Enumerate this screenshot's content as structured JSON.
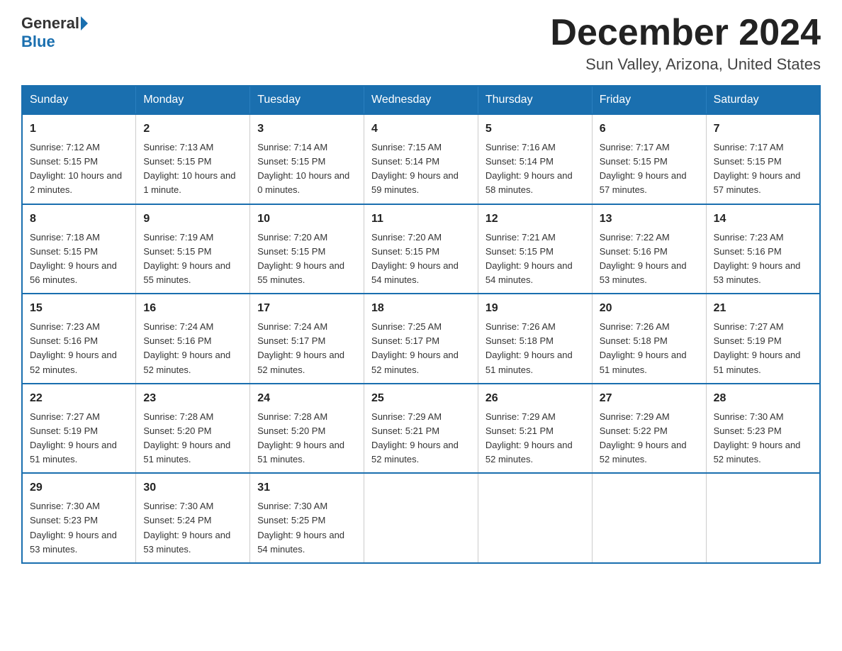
{
  "logo": {
    "general": "General",
    "blue": "Blue"
  },
  "title": "December 2024",
  "location": "Sun Valley, Arizona, United States",
  "days_of_week": [
    "Sunday",
    "Monday",
    "Tuesday",
    "Wednesday",
    "Thursday",
    "Friday",
    "Saturday"
  ],
  "weeks": [
    [
      {
        "day": "1",
        "sunrise": "7:12 AM",
        "sunset": "5:15 PM",
        "daylight": "10 hours and 2 minutes."
      },
      {
        "day": "2",
        "sunrise": "7:13 AM",
        "sunset": "5:15 PM",
        "daylight": "10 hours and 1 minute."
      },
      {
        "day": "3",
        "sunrise": "7:14 AM",
        "sunset": "5:15 PM",
        "daylight": "10 hours and 0 minutes."
      },
      {
        "day": "4",
        "sunrise": "7:15 AM",
        "sunset": "5:14 PM",
        "daylight": "9 hours and 59 minutes."
      },
      {
        "day": "5",
        "sunrise": "7:16 AM",
        "sunset": "5:14 PM",
        "daylight": "9 hours and 58 minutes."
      },
      {
        "day": "6",
        "sunrise": "7:17 AM",
        "sunset": "5:15 PM",
        "daylight": "9 hours and 57 minutes."
      },
      {
        "day": "7",
        "sunrise": "7:17 AM",
        "sunset": "5:15 PM",
        "daylight": "9 hours and 57 minutes."
      }
    ],
    [
      {
        "day": "8",
        "sunrise": "7:18 AM",
        "sunset": "5:15 PM",
        "daylight": "9 hours and 56 minutes."
      },
      {
        "day": "9",
        "sunrise": "7:19 AM",
        "sunset": "5:15 PM",
        "daylight": "9 hours and 55 minutes."
      },
      {
        "day": "10",
        "sunrise": "7:20 AM",
        "sunset": "5:15 PM",
        "daylight": "9 hours and 55 minutes."
      },
      {
        "day": "11",
        "sunrise": "7:20 AM",
        "sunset": "5:15 PM",
        "daylight": "9 hours and 54 minutes."
      },
      {
        "day": "12",
        "sunrise": "7:21 AM",
        "sunset": "5:15 PM",
        "daylight": "9 hours and 54 minutes."
      },
      {
        "day": "13",
        "sunrise": "7:22 AM",
        "sunset": "5:16 PM",
        "daylight": "9 hours and 53 minutes."
      },
      {
        "day": "14",
        "sunrise": "7:23 AM",
        "sunset": "5:16 PM",
        "daylight": "9 hours and 53 minutes."
      }
    ],
    [
      {
        "day": "15",
        "sunrise": "7:23 AM",
        "sunset": "5:16 PM",
        "daylight": "9 hours and 52 minutes."
      },
      {
        "day": "16",
        "sunrise": "7:24 AM",
        "sunset": "5:16 PM",
        "daylight": "9 hours and 52 minutes."
      },
      {
        "day": "17",
        "sunrise": "7:24 AM",
        "sunset": "5:17 PM",
        "daylight": "9 hours and 52 minutes."
      },
      {
        "day": "18",
        "sunrise": "7:25 AM",
        "sunset": "5:17 PM",
        "daylight": "9 hours and 52 minutes."
      },
      {
        "day": "19",
        "sunrise": "7:26 AM",
        "sunset": "5:18 PM",
        "daylight": "9 hours and 51 minutes."
      },
      {
        "day": "20",
        "sunrise": "7:26 AM",
        "sunset": "5:18 PM",
        "daylight": "9 hours and 51 minutes."
      },
      {
        "day": "21",
        "sunrise": "7:27 AM",
        "sunset": "5:19 PM",
        "daylight": "9 hours and 51 minutes."
      }
    ],
    [
      {
        "day": "22",
        "sunrise": "7:27 AM",
        "sunset": "5:19 PM",
        "daylight": "9 hours and 51 minutes."
      },
      {
        "day": "23",
        "sunrise": "7:28 AM",
        "sunset": "5:20 PM",
        "daylight": "9 hours and 51 minutes."
      },
      {
        "day": "24",
        "sunrise": "7:28 AM",
        "sunset": "5:20 PM",
        "daylight": "9 hours and 51 minutes."
      },
      {
        "day": "25",
        "sunrise": "7:29 AM",
        "sunset": "5:21 PM",
        "daylight": "9 hours and 52 minutes."
      },
      {
        "day": "26",
        "sunrise": "7:29 AM",
        "sunset": "5:21 PM",
        "daylight": "9 hours and 52 minutes."
      },
      {
        "day": "27",
        "sunrise": "7:29 AM",
        "sunset": "5:22 PM",
        "daylight": "9 hours and 52 minutes."
      },
      {
        "day": "28",
        "sunrise": "7:30 AM",
        "sunset": "5:23 PM",
        "daylight": "9 hours and 52 minutes."
      }
    ],
    [
      {
        "day": "29",
        "sunrise": "7:30 AM",
        "sunset": "5:23 PM",
        "daylight": "9 hours and 53 minutes."
      },
      {
        "day": "30",
        "sunrise": "7:30 AM",
        "sunset": "5:24 PM",
        "daylight": "9 hours and 53 minutes."
      },
      {
        "day": "31",
        "sunrise": "7:30 AM",
        "sunset": "5:25 PM",
        "daylight": "9 hours and 54 minutes."
      },
      null,
      null,
      null,
      null
    ]
  ]
}
